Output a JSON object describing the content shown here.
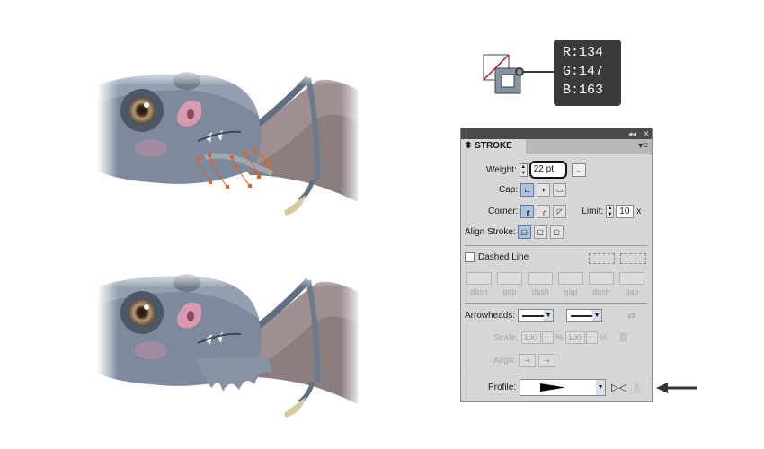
{
  "tooltip": {
    "r": "R:134",
    "g": "G:147",
    "b": "B:163"
  },
  "stroke_color": "#8693a3",
  "panel": {
    "tab_label": "STROKE",
    "weight_label": "Weight:",
    "weight_value": "22 pt",
    "cap_label": "Cap:",
    "corner_label": "Corner:",
    "limit_label": "Limit:",
    "limit_value": "10",
    "limit_unit": "x",
    "align_label": "Align Stroke:",
    "dashed_label": "Dashed Line",
    "dash_labels": [
      "dash",
      "gap",
      "dash",
      "gap",
      "dash",
      "gap"
    ],
    "arrowheads_label": "Arrowheads:",
    "scale_label": "Scale:",
    "scale_values": [
      "100",
      "100"
    ],
    "pct": "%",
    "align_arrow_label": "Align:",
    "profile_label": "Profile:"
  },
  "icons": {
    "swap": "swap-arrowheads-icon",
    "link": "link-icon",
    "flip_along": "flip-along-icon",
    "flip_across": "flip-across-icon",
    "pointer": "pointer-arrow-icon"
  }
}
